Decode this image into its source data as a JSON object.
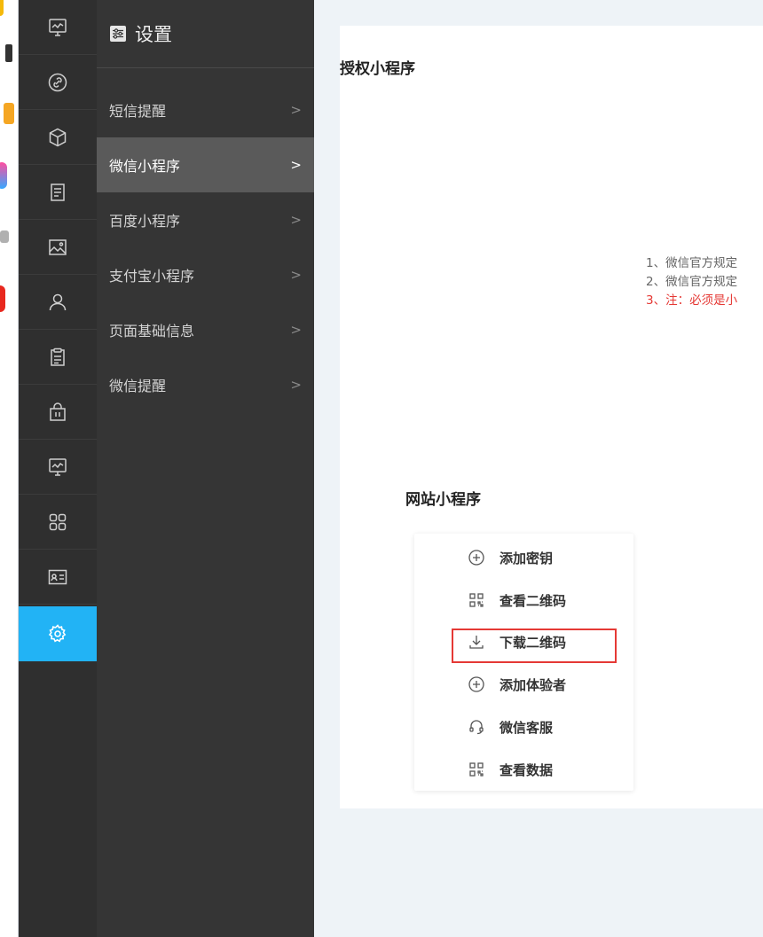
{
  "submenu": {
    "title": "设置",
    "items": [
      {
        "label": "短信提醒",
        "chevron": ">"
      },
      {
        "label": "微信小程序",
        "chevron": ">"
      },
      {
        "label": "百度小程序",
        "chevron": ">"
      },
      {
        "label": "支付宝小程序",
        "chevron": ">"
      },
      {
        "label": "页面基础信息",
        "chevron": ">"
      },
      {
        "label": "微信提醒",
        "chevron": ">"
      }
    ],
    "active_index": 1
  },
  "rail": {
    "icons": [
      "monitor-chart-icon",
      "link-circle-icon",
      "cube-icon",
      "document-icon",
      "image-icon",
      "user-icon",
      "clipboard-icon",
      "shopping-bag-icon",
      "monitor-chart-icon",
      "grid-icon",
      "id-card-icon",
      "gear-icon"
    ],
    "active_index": 11,
    "active_color": "#22b3f5"
  },
  "main": {
    "card_title": "授权小程序",
    "notes": [
      "1、微信官方规定",
      "2、微信官方规定",
      "3、注：必须是小"
    ],
    "section_title": "网站小程序",
    "actions": [
      {
        "label": "添加密钥",
        "icon": "plus-circle-icon"
      },
      {
        "label": "查看二维码",
        "icon": "qrcode-icon"
      },
      {
        "label": "下载二维码",
        "icon": "download-icon"
      },
      {
        "label": "添加体验者",
        "icon": "plus-circle-icon"
      },
      {
        "label": "微信客服",
        "icon": "headset-icon"
      },
      {
        "label": "查看数据",
        "icon": "qrcode-icon"
      }
    ],
    "highlighted_action": "下载二维码",
    "warn_color": "#e53935"
  }
}
